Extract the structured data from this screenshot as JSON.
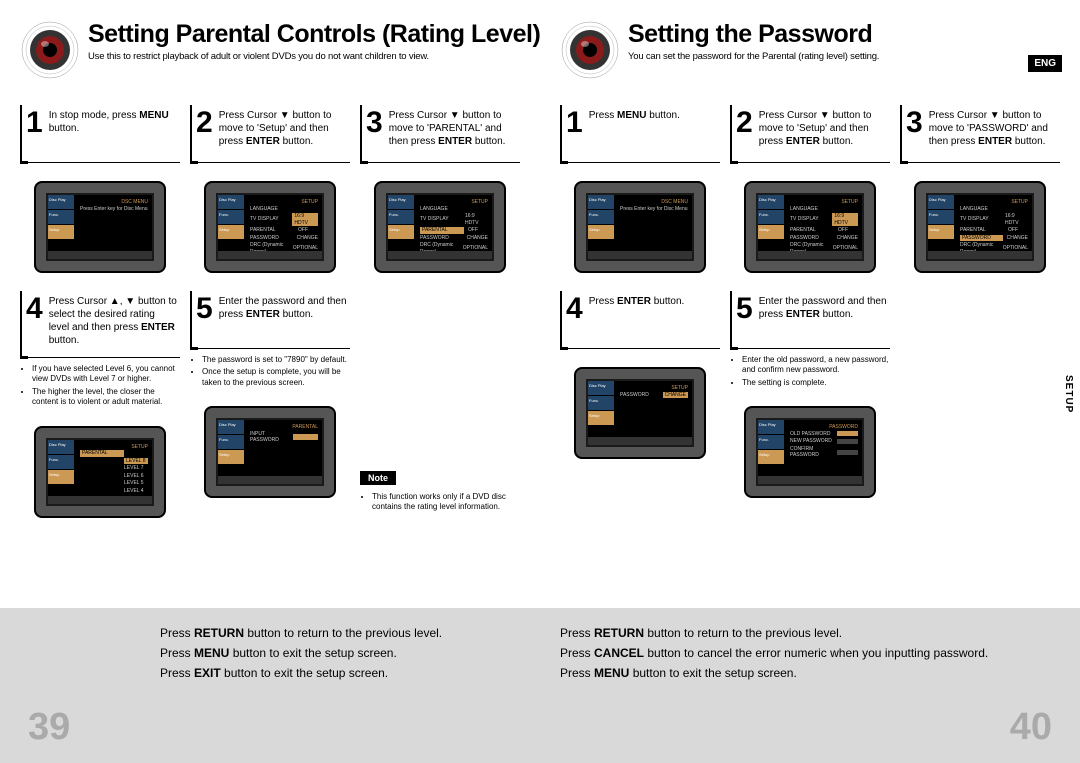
{
  "lang_badge": "ENG",
  "setup_tab": "SETUP",
  "left": {
    "title": "Setting Parental Controls (Rating Level)",
    "subtitle": "Use this to restrict playback of adult or violent DVDs you do not want children to view.",
    "steps_top": [
      {
        "num": "1",
        "html": "In stop mode, press <b>MENU</b> button."
      },
      {
        "num": "2",
        "html": "Press Cursor ▼ button to move to 'Setup' and then press <b>ENTER</b> button."
      },
      {
        "num": "3",
        "html": "Press Cursor ▼ button to move to 'PARENTAL' and then press <b>ENTER</b> button."
      }
    ],
    "steps_bottom": [
      {
        "num": "4",
        "html": "Press Cursor ▲, ▼ button to select the desired rating level and then press <b>ENTER</b> button.",
        "bullets": [
          "If you have selected Level 6, you cannot view DVDs with Level 7 or higher.",
          "The higher the level, the closer the content is to violent or adult material."
        ]
      },
      {
        "num": "5",
        "html": "Enter the password and then press <b>ENTER</b> button.",
        "bullets": [
          "The password is set to \"7890\" by default.",
          "Once the setup is complete, you will be taken to the previous screen."
        ]
      }
    ],
    "note_label": "Note",
    "note_bullets": [
      "This function works only if a DVD disc contains the rating level information."
    ],
    "footer": [
      "Press <b>RETURN</b> button to return to the previous level.",
      "Press <b>MENU</b> button to exit the setup screen.",
      "Press <b>EXIT</b> button to exit the setup screen."
    ],
    "page_num": "39"
  },
  "right": {
    "title": "Setting the Password",
    "subtitle": "You can set the password for the Parental (rating level) setting.",
    "steps_top": [
      {
        "num": "1",
        "html": "Press <b>MENU</b> button."
      },
      {
        "num": "2",
        "html": "Press Cursor ▼ button to move to 'Setup' and then press <b>ENTER</b> button."
      },
      {
        "num": "3",
        "html": "Press Cursor ▼ button to move to 'PASSWORD' and then press <b>ENTER</b> button."
      }
    ],
    "steps_bottom": [
      {
        "num": "4",
        "html": "Press <b>ENTER</b> button."
      },
      {
        "num": "5",
        "html": "Enter the password and then press <b>ENTER</b> button.",
        "bullets": [
          "Enter the old password, a new password, and confirm new password.",
          "The setting is complete."
        ]
      }
    ],
    "footer": [
      "Press <b>RETURN</b> button to return to the previous level.",
      "Press <b>CANCEL</b> button to cancel the error numeric when you inputting password.",
      "Press <b>MENU</b> button to exit the setup screen."
    ],
    "page_num": "40"
  },
  "osd": {
    "menu_items": [
      "LANGUAGE",
      "TV DISPLAY",
      "PARENTAL",
      "PASSWORD",
      "DRC (Dynamic Range)"
    ],
    "menu_vals": [
      "",
      "16:9 HDTV",
      "OFF",
      "CHANGE",
      "OPTIONAL"
    ],
    "tabs": [
      "Disc Play",
      "Func.",
      "Setup"
    ],
    "prompt": "Press Enter key for Disc Menu",
    "title_bar": "DSC MENU",
    "setup_bar": "SETUP",
    "parental_bar": "PARENTAL",
    "password_bar": "PASSWORD",
    "levels": [
      "LEVEL 8",
      "LEVEL 7",
      "LEVEL 6",
      "LEVEL 5",
      "LEVEL 4"
    ],
    "pw_fields": [
      "OLD PASSWORD",
      "NEW PASSWORD",
      "CONFIRM PASSWORD"
    ],
    "input_pw": "INPUT PASSWORD"
  }
}
